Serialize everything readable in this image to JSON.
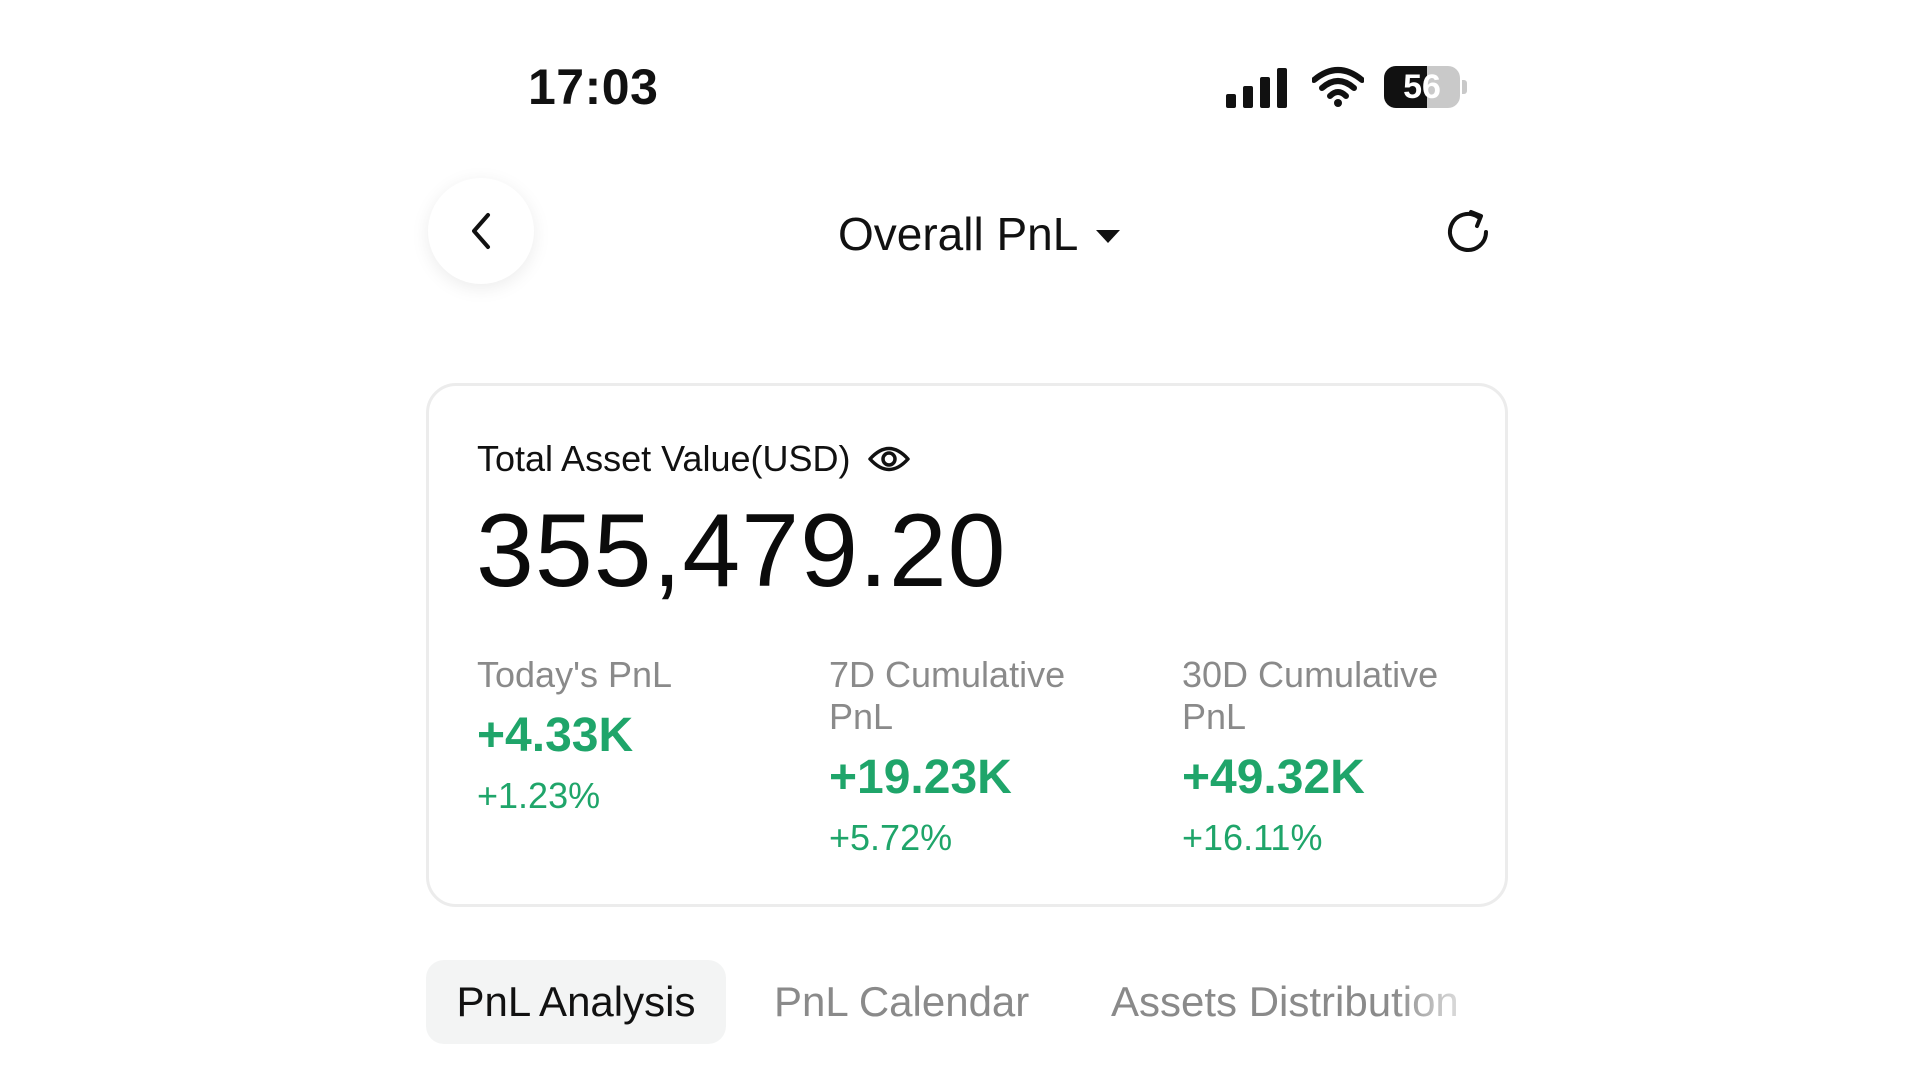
{
  "status_bar": {
    "time": "17:03",
    "battery": "56",
    "icons": [
      "signal-icon",
      "wifi-icon",
      "battery-icon"
    ]
  },
  "header": {
    "title": "Overall PnL",
    "icons": [
      "back-chevron-icon",
      "caret-down-icon",
      "refresh-icon"
    ]
  },
  "summary": {
    "total_label": "Total Asset Value(USD)",
    "total_value": "355,479.20",
    "eye_icon": "eye-icon",
    "stats": [
      {
        "label": "Today's PnL",
        "amount": "+4.33K",
        "percent": "+1.23%"
      },
      {
        "label": "7D Cumulative PnL",
        "amount": "+19.23K",
        "percent": "+5.72%"
      },
      {
        "label": "30D Cumulative PnL",
        "amount": "+49.32K",
        "percent": "+16.11%"
      }
    ]
  },
  "tabs": [
    {
      "label": "PnL Analysis",
      "active": true
    },
    {
      "label": "PnL Calendar",
      "active": false
    },
    {
      "label": "Assets Distribution",
      "active": false
    }
  ],
  "colors": {
    "positive": "#1fa56a",
    "text_primary": "#111111",
    "text_secondary": "#8a8a8a",
    "card_border": "#ececec",
    "tab_active_bg": "#f3f4f4"
  }
}
